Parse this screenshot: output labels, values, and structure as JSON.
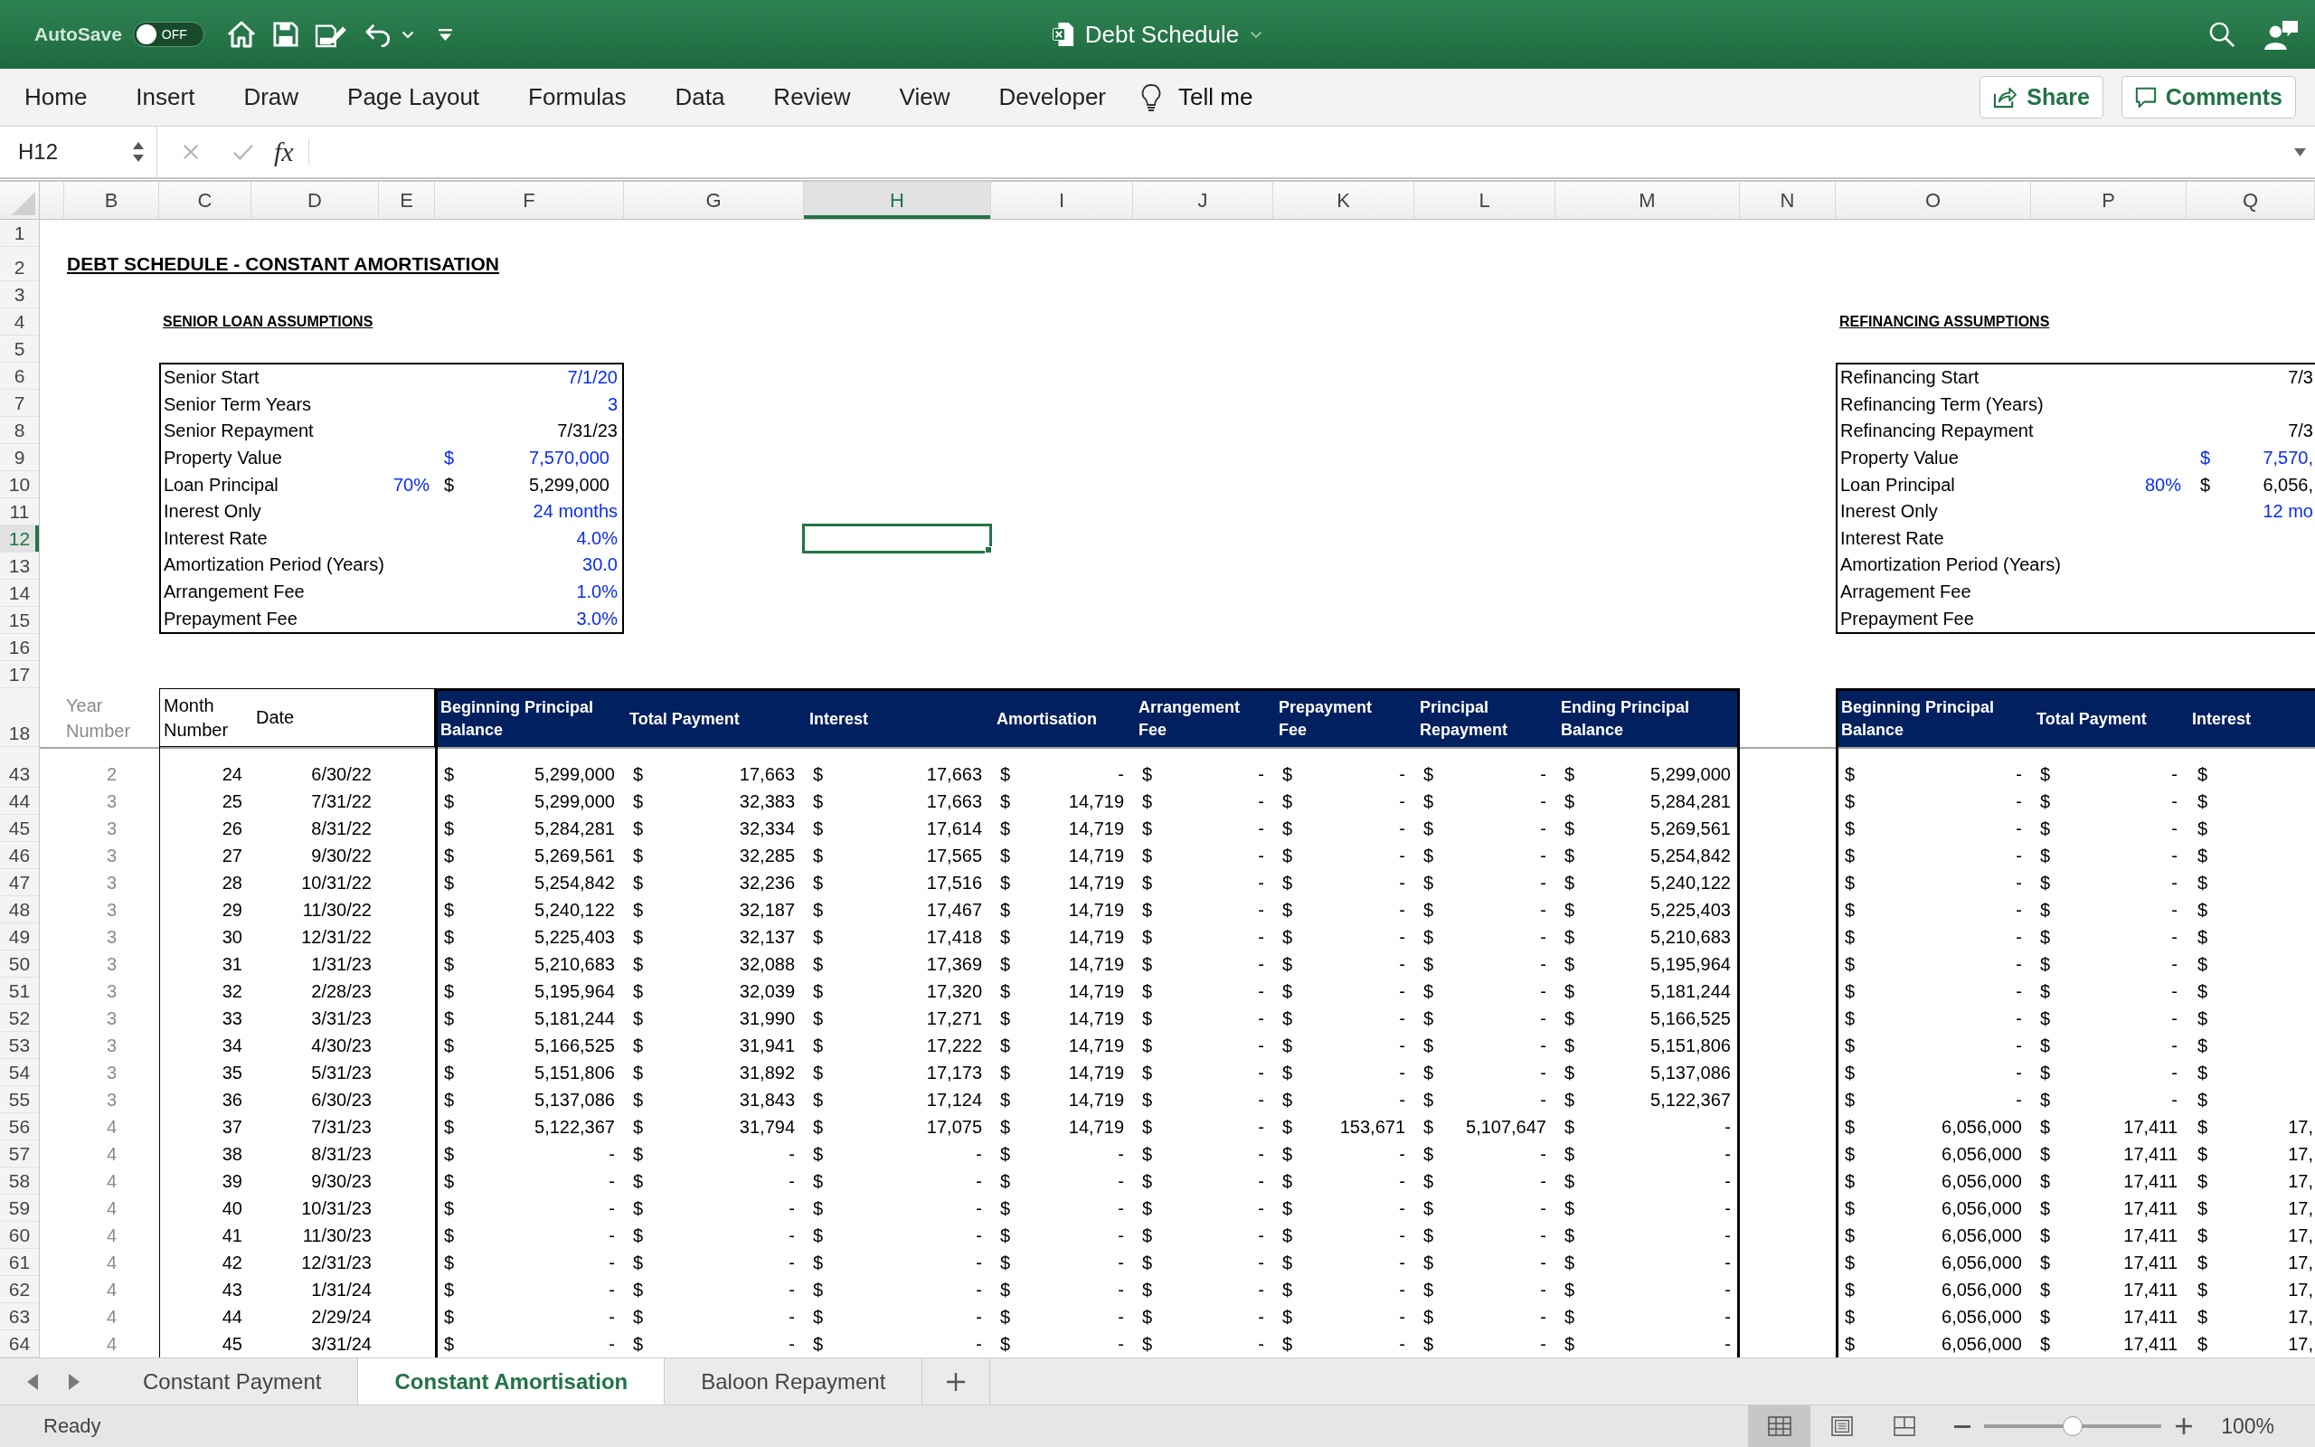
{
  "title_bar": {
    "autosave_label": "AutoSave",
    "autosave_toggle": {
      "on": false,
      "label": "OFF"
    },
    "document_title": "Debt Schedule"
  },
  "ribbon": {
    "tabs": [
      {
        "label": "Home",
        "selected": false
      },
      {
        "label": "Insert",
        "selected": false
      },
      {
        "label": "Draw",
        "selected": false
      },
      {
        "label": "Page Layout",
        "selected": false
      },
      {
        "label": "Formulas",
        "selected": false
      },
      {
        "label": "Data",
        "selected": false
      },
      {
        "label": "Review",
        "selected": false
      },
      {
        "label": "View",
        "selected": false
      },
      {
        "label": "Developer",
        "selected": false
      }
    ],
    "tell_me": "Tell me",
    "share": "Share",
    "comments": "Comments"
  },
  "formula_bar": {
    "name_box": "H12",
    "insert_function": "fx"
  },
  "sheet": {
    "columns": [
      {
        "label": "B",
        "selected": false
      },
      {
        "label": "C",
        "selected": false
      },
      {
        "label": "D",
        "selected": false
      },
      {
        "label": "E",
        "selected": false
      },
      {
        "label": "F",
        "selected": false
      },
      {
        "label": "G",
        "selected": false
      },
      {
        "label": "H",
        "selected": true
      },
      {
        "label": "I",
        "selected": false
      },
      {
        "label": "J",
        "selected": false
      },
      {
        "label": "K",
        "selected": false
      },
      {
        "label": "L",
        "selected": false
      },
      {
        "label": "M",
        "selected": false
      },
      {
        "label": "N",
        "selected": false
      },
      {
        "label": "O",
        "selected": false
      },
      {
        "label": "P",
        "selected": false
      },
      {
        "label": "Q",
        "selected": false
      }
    ],
    "row_numbers": [
      {
        "label": "1",
        "selected": false
      },
      {
        "label": "2",
        "selected": false
      },
      {
        "label": "3",
        "selected": false
      },
      {
        "label": "4",
        "selected": false
      },
      {
        "label": "5",
        "selected": false
      },
      {
        "label": "6",
        "selected": false
      },
      {
        "label": "7",
        "selected": false
      },
      {
        "label": "8",
        "selected": false
      },
      {
        "label": "9",
        "selected": false
      },
      {
        "label": "10",
        "selected": false
      },
      {
        "label": "11",
        "selected": false
      },
      {
        "label": "12",
        "selected": true
      },
      {
        "label": "13",
        "selected": false
      },
      {
        "label": "14",
        "selected": false
      },
      {
        "label": "15",
        "selected": false
      },
      {
        "label": "16",
        "selected": false
      },
      {
        "label": "17",
        "selected": false
      },
      {
        "label": "18",
        "selected": false
      },
      {
        "label": "43",
        "selected": false
      },
      {
        "label": "44",
        "selected": false
      },
      {
        "label": "45",
        "selected": false
      },
      {
        "label": "46",
        "selected": false
      },
      {
        "label": "47",
        "selected": false
      },
      {
        "label": "48",
        "selected": false
      },
      {
        "label": "49",
        "selected": false
      },
      {
        "label": "50",
        "selected": false
      },
      {
        "label": "51",
        "selected": false
      },
      {
        "label": "52",
        "selected": false
      },
      {
        "label": "53",
        "selected": false
      },
      {
        "label": "54",
        "selected": false
      },
      {
        "label": "55",
        "selected": false
      },
      {
        "label": "56",
        "selected": false
      },
      {
        "label": "57",
        "selected": false
      },
      {
        "label": "58",
        "selected": false
      },
      {
        "label": "59",
        "selected": false
      },
      {
        "label": "60",
        "selected": false
      },
      {
        "label": "61",
        "selected": false
      },
      {
        "label": "62",
        "selected": false
      },
      {
        "label": "63",
        "selected": false
      },
      {
        "label": "64",
        "selected": false
      }
    ],
    "title": "DEBT SCHEDULE - CONSTANT AMORTISATION",
    "senior_assumptions": {
      "heading": "SENIOR LOAN ASSUMPTIONS",
      "rows": [
        {
          "label": "Senior Start",
          "kind": "plain",
          "value": "7/1/20",
          "input": true
        },
        {
          "label": "Senior Term Years",
          "kind": "plain",
          "value": "3",
          "input": true
        },
        {
          "label": "Senior Repayment",
          "kind": "plain",
          "value": "7/31/23",
          "input": false
        },
        {
          "label": "Property Value",
          "kind": "money",
          "value": "$ 7,570,000",
          "input": true
        },
        {
          "label": "Loan Principal",
          "percent": "70%",
          "percent_input": true,
          "kind": "money",
          "value": "$ 5,299,000",
          "input": false
        },
        {
          "label": "Inerest Only",
          "kind": "plain",
          "value": "24 months",
          "input": true
        },
        {
          "label": "Interest Rate",
          "kind": "plain",
          "value": "4.0%",
          "input": true
        },
        {
          "label": "Amortization Period (Years)",
          "kind": "plain",
          "value": "30.0",
          "input": true
        },
        {
          "label": "Arrangement Fee",
          "kind": "plain",
          "value": "1.0%",
          "input": true
        },
        {
          "label": "Prepayment Fee",
          "kind": "plain",
          "value": "3.0%",
          "input": true
        }
      ]
    },
    "refinancing_assumptions": {
      "heading": "REFINANCING ASSUMPTIONS",
      "rows": [
        {
          "label": "Refinancing Start",
          "kind": "plain",
          "value": "7/3",
          "input": false
        },
        {
          "label": "Refinancing Term (Years)"
        },
        {
          "label": "Refinancing Repayment",
          "kind": "plain",
          "value": "7/3",
          "input": false
        },
        {
          "label": "Property Value",
          "kind": "money",
          "value": "$ 7,570,",
          "input": true
        },
        {
          "label": "Loan Principal",
          "percent": "80%",
          "percent_input": true,
          "kind": "money",
          "value": "$ 6,056,",
          "input": false
        },
        {
          "label": "Inerest Only",
          "kind": "plain",
          "value": "12 mo",
          "input": true
        },
        {
          "label": "Interest Rate"
        },
        {
          "label": "Amortization Period (Years)"
        },
        {
          "label": "Arragement Fee"
        },
        {
          "label": "Prepayment Fee"
        }
      ]
    },
    "schedule": {
      "columns": [
        "Year Number",
        "Month Number",
        "Date",
        "Beginning Principal Balance",
        "Total Payment",
        "Interest",
        "Amortisation",
        "Arrangement Fee",
        "Prepayment Fee",
        "Principal Repayment",
        "Ending Principal Balance"
      ],
      "rows": [
        [
          "2",
          "24",
          "6/30/22",
          "$ 5,299,000",
          "$ 17,663",
          "$ 17,663",
          "$ -",
          "$ -",
          "$ -",
          "$ -",
          "$ 5,299,000"
        ],
        [
          "3",
          "25",
          "7/31/22",
          "$ 5,299,000",
          "$ 32,383",
          "$ 17,663",
          "$ 14,719",
          "$ -",
          "$ -",
          "$ -",
          "$ 5,284,281"
        ],
        [
          "3",
          "26",
          "8/31/22",
          "$ 5,284,281",
          "$ 32,334",
          "$ 17,614",
          "$ 14,719",
          "$ -",
          "$ -",
          "$ -",
          "$ 5,269,561"
        ],
        [
          "3",
          "27",
          "9/30/22",
          "$ 5,269,561",
          "$ 32,285",
          "$ 17,565",
          "$ 14,719",
          "$ -",
          "$ -",
          "$ -",
          "$ 5,254,842"
        ],
        [
          "3",
          "28",
          "10/31/22",
          "$ 5,254,842",
          "$ 32,236",
          "$ 17,516",
          "$ 14,719",
          "$ -",
          "$ -",
          "$ -",
          "$ 5,240,122"
        ],
        [
          "3",
          "29",
          "11/30/22",
          "$ 5,240,122",
          "$ 32,187",
          "$ 17,467",
          "$ 14,719",
          "$ -",
          "$ -",
          "$ -",
          "$ 5,225,403"
        ],
        [
          "3",
          "30",
          "12/31/22",
          "$ 5,225,403",
          "$ 32,137",
          "$ 17,418",
          "$ 14,719",
          "$ -",
          "$ -",
          "$ -",
          "$ 5,210,683"
        ],
        [
          "3",
          "31",
          "1/31/23",
          "$ 5,210,683",
          "$ 32,088",
          "$ 17,369",
          "$ 14,719",
          "$ -",
          "$ -",
          "$ -",
          "$ 5,195,964"
        ],
        [
          "3",
          "32",
          "2/28/23",
          "$ 5,195,964",
          "$ 32,039",
          "$ 17,320",
          "$ 14,719",
          "$ -",
          "$ -",
          "$ -",
          "$ 5,181,244"
        ],
        [
          "3",
          "33",
          "3/31/23",
          "$ 5,181,244",
          "$ 31,990",
          "$ 17,271",
          "$ 14,719",
          "$ -",
          "$ -",
          "$ -",
          "$ 5,166,525"
        ],
        [
          "3",
          "34",
          "4/30/23",
          "$ 5,166,525",
          "$ 31,941",
          "$ 17,222",
          "$ 14,719",
          "$ -",
          "$ -",
          "$ -",
          "$ 5,151,806"
        ],
        [
          "3",
          "35",
          "5/31/23",
          "$ 5,151,806",
          "$ 31,892",
          "$ 17,173",
          "$ 14,719",
          "$ -",
          "$ -",
          "$ -",
          "$ 5,137,086"
        ],
        [
          "3",
          "36",
          "6/30/23",
          "$ 5,137,086",
          "$ 31,843",
          "$ 17,124",
          "$ 14,719",
          "$ -",
          "$ -",
          "$ -",
          "$ 5,122,367"
        ],
        [
          "4",
          "37",
          "7/31/23",
          "$ 5,122,367",
          "$ 31,794",
          "$ 17,075",
          "$ 14,719",
          "$ -",
          "$ 153,671",
          "$ 5,107,647",
          "$ -"
        ],
        [
          "4",
          "38",
          "8/31/23",
          "$ -",
          "$ -",
          "$ -",
          "$ -",
          "$ -",
          "$ -",
          "$ -",
          "$ -"
        ],
        [
          "4",
          "39",
          "9/30/23",
          "$ -",
          "$ -",
          "$ -",
          "$ -",
          "$ -",
          "$ -",
          "$ -",
          "$ -"
        ],
        [
          "4",
          "40",
          "10/31/23",
          "$ -",
          "$ -",
          "$ -",
          "$ -",
          "$ -",
          "$ -",
          "$ -",
          "$ -"
        ],
        [
          "4",
          "41",
          "11/30/23",
          "$ -",
          "$ -",
          "$ -",
          "$ -",
          "$ -",
          "$ -",
          "$ -",
          "$ -"
        ],
        [
          "4",
          "42",
          "12/31/23",
          "$ -",
          "$ -",
          "$ -",
          "$ -",
          "$ -",
          "$ -",
          "$ -",
          "$ -"
        ],
        [
          "4",
          "43",
          "1/31/24",
          "$ -",
          "$ -",
          "$ -",
          "$ -",
          "$ -",
          "$ -",
          "$ -",
          "$ -"
        ],
        [
          "4",
          "44",
          "2/29/24",
          "$ -",
          "$ -",
          "$ -",
          "$ -",
          "$ -",
          "$ -",
          "$ -",
          "$ -"
        ],
        [
          "4",
          "45",
          "3/31/24",
          "$ -",
          "$ -",
          "$ -",
          "$ -",
          "$ -",
          "$ -",
          "$ -",
          "$ -"
        ]
      ]
    },
    "refinancing_schedule": {
      "columns": [
        "Beginning Principal Balance",
        "Total Payment",
        "Interest"
      ],
      "rows": [
        [
          "$ -",
          "$ -",
          "$"
        ],
        [
          "$ -",
          "$ -",
          "$"
        ],
        [
          "$ -",
          "$ -",
          "$"
        ],
        [
          "$ -",
          "$ -",
          "$"
        ],
        [
          "$ -",
          "$ -",
          "$"
        ],
        [
          "$ -",
          "$ -",
          "$"
        ],
        [
          "$ -",
          "$ -",
          "$"
        ],
        [
          "$ -",
          "$ -",
          "$"
        ],
        [
          "$ -",
          "$ -",
          "$"
        ],
        [
          "$ -",
          "$ -",
          "$"
        ],
        [
          "$ -",
          "$ -",
          "$"
        ],
        [
          "$ -",
          "$ -",
          "$"
        ],
        [
          "$ -",
          "$ -",
          "$"
        ],
        [
          "$ 6,056,000",
          "$ 17,411",
          "$ 17,"
        ],
        [
          "$ 6,056,000",
          "$ 17,411",
          "$ 17,"
        ],
        [
          "$ 6,056,000",
          "$ 17,411",
          "$ 17,"
        ],
        [
          "$ 6,056,000",
          "$ 17,411",
          "$ 17,"
        ],
        [
          "$ 6,056,000",
          "$ 17,411",
          "$ 17,"
        ],
        [
          "$ 6,056,000",
          "$ 17,411",
          "$ 17,"
        ],
        [
          "$ 6,056,000",
          "$ 17,411",
          "$ 17,"
        ],
        [
          "$ 6,056,000",
          "$ 17,411",
          "$ 17,"
        ],
        [
          "$ 6,056,000",
          "$ 17,411",
          "$ 17,"
        ]
      ]
    }
  },
  "sheet_tabs": [
    {
      "label": "Constant Payment",
      "selected": false
    },
    {
      "label": "Constant Amortisation",
      "selected": true
    },
    {
      "label": "Baloon Repayment",
      "selected": false
    }
  ],
  "status_bar": {
    "status": "Ready",
    "views": [
      {
        "kind": "normal",
        "selected": true
      },
      {
        "kind": "page_layout",
        "selected": false
      },
      {
        "kind": "page_break_preview",
        "selected": false
      }
    ],
    "zoom": {
      "level": 0.5
    },
    "zoom_label": "100%"
  }
}
